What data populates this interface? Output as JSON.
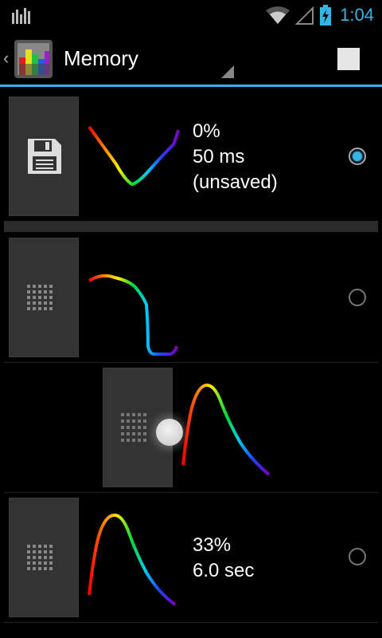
{
  "statusbar": {
    "time": "1:04",
    "time_color": "#33b5e5",
    "icons": [
      "equalizer-icon",
      "wifi-icon",
      "signal-icon",
      "battery-charging-icon"
    ]
  },
  "actionbar": {
    "title": "Memory",
    "accent_color": "#33b5e5",
    "icons": [
      "back-chevron-icon",
      "app-icon",
      "spinner-icon",
      "stop-icon"
    ]
  },
  "slots": [
    {
      "icon": "floppy-disk-icon",
      "curve": "v-shape",
      "line1": "0%",
      "line2": "50 ms",
      "line3": "(unsaved)",
      "selected": true
    },
    {
      "icon": "grid-icon",
      "curve": "step-down",
      "line1": "",
      "line2": "",
      "line3": "",
      "selected": false
    },
    {
      "icon": "grid-icon",
      "curve": "peak",
      "line1": "",
      "line2": "",
      "line3": "",
      "selected": false,
      "dragging": true
    },
    {
      "icon": "grid-icon",
      "curve": "peak",
      "line1": "33%",
      "line2": "6.0 sec",
      "line3": "",
      "selected": false
    }
  ]
}
